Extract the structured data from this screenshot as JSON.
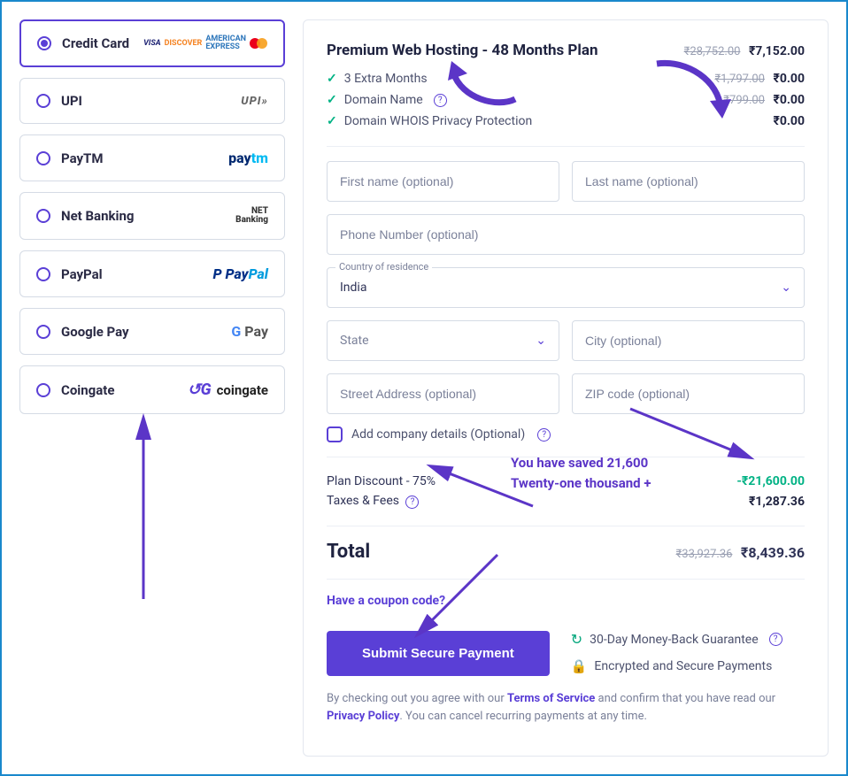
{
  "payment_methods": [
    {
      "label": "Credit Card",
      "selected": true
    },
    {
      "label": "UPI",
      "selected": false
    },
    {
      "label": "PayTM",
      "selected": false
    },
    {
      "label": "Net Banking",
      "selected": false
    },
    {
      "label": "PayPal",
      "selected": false
    },
    {
      "label": "Google Pay",
      "selected": false
    },
    {
      "label": "Coingate",
      "selected": false
    }
  ],
  "plan": {
    "title": "Premium Web Hosting - 48 Months Plan",
    "orig_price": "₹28,752.00",
    "price": "₹7,152.00",
    "includes": [
      {
        "label": "3 Extra Months",
        "orig": "₹1,797.00",
        "price": "₹0.00",
        "help": false
      },
      {
        "label": "Domain Name",
        "orig": "₹799.00",
        "price": "₹0.00",
        "help": true
      },
      {
        "label": "Domain WHOIS Privacy Protection",
        "orig": "",
        "price": "₹0.00",
        "help": false
      }
    ]
  },
  "form": {
    "first_name_ph": "First name (optional)",
    "last_name_ph": "Last name (optional)",
    "phone_ph": "Phone Number (optional)",
    "country_label": "Country of residence",
    "country_value": "India",
    "state_ph": "State",
    "city_ph": "City (optional)",
    "street_ph": "Street Address (optional)",
    "zip_ph": "ZIP code (optional)",
    "company_label": "Add company details (Optional)"
  },
  "summary": {
    "discount_label": "Plan Discount - 75%",
    "discount_value": "-₹21,600.00",
    "taxes_label": "Taxes & Fees",
    "taxes_value": "₹1,287.36",
    "total_label": "Total",
    "total_orig": "₹33,927.36",
    "total_value": "₹8,439.36"
  },
  "coupon_label": "Have a coupon code?",
  "submit_label": "Submit Secure Payment",
  "assurances": {
    "moneyback": "30-Day Money-Back Guarantee",
    "encrypted": "Encrypted and Secure Payments"
  },
  "legal": {
    "pre": "By checking out you agree with our ",
    "tos": "Terms of Service",
    "mid": " and confirm that you have read our ",
    "pp": "Privacy Policy",
    "post": ". You can cancel recurring payments at any time."
  },
  "annotations": {
    "saved_line1": "You have saved 21,600",
    "saved_line2": "Twenty-one thousand +"
  }
}
